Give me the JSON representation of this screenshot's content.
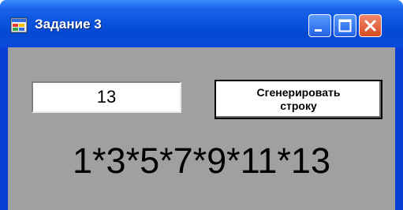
{
  "window": {
    "title": "Задание 3",
    "icon": "application-window-icon",
    "controls": [
      "minimize-icon",
      "maximize-icon",
      "close-icon"
    ]
  },
  "form": {
    "input_value": "13",
    "generate_button_line1": "Сгенерировать",
    "generate_button_line2": "строку",
    "result_text": "1*3*5*7*9*11*13"
  },
  "colors": {
    "title_bar": "#0a54e0",
    "client_background": "#a0a0a0",
    "close_button": "#d84a20"
  }
}
